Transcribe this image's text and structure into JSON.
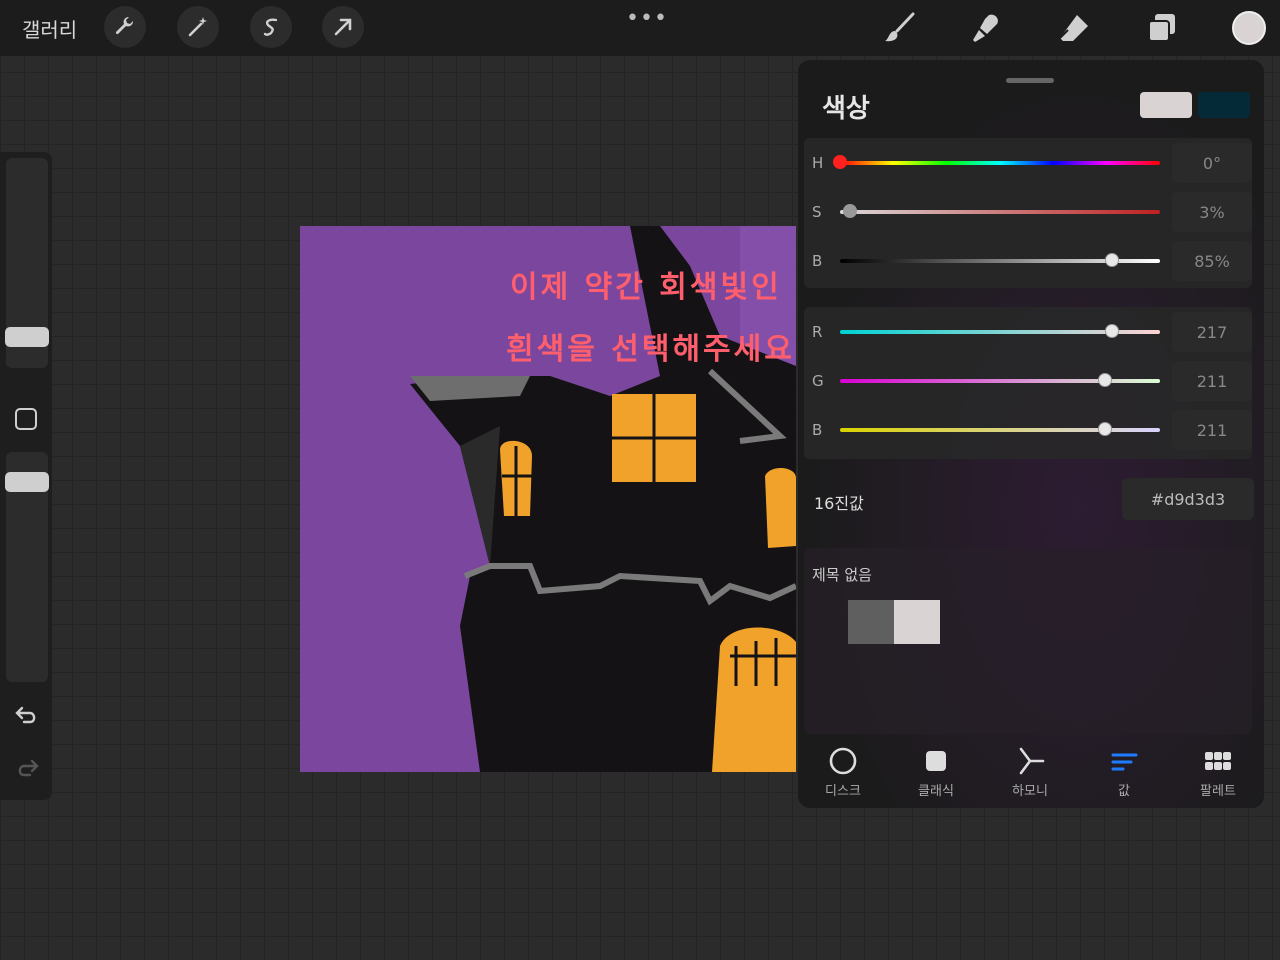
{
  "topbar": {
    "gallery_label": "갤러리",
    "tools": [
      "wrench-icon",
      "magic-wand-icon",
      "selection-icon",
      "transform-arrow-icon"
    ],
    "menu_dots": "•••",
    "right_tools": [
      "brush-icon",
      "smudge-icon",
      "eraser-icon",
      "layers-icon"
    ],
    "current_color": "#d9d3d3"
  },
  "canvas": {
    "text_line1": "이제 약간 회색빛인",
    "text_line2": "흰색을 선택해주세요.",
    "background": "#7a469e"
  },
  "panel": {
    "title": "색상",
    "primary_color": "#d9d3d3",
    "secondary_color": "#032a36",
    "hsb": [
      {
        "label": "H",
        "value": "0°",
        "fraction": 0.0
      },
      {
        "label": "S",
        "value": "3%",
        "fraction": 0.03
      },
      {
        "label": "B",
        "value": "85%",
        "fraction": 0.85
      }
    ],
    "rgb": [
      {
        "label": "R",
        "value": "217",
        "fraction": 0.851
      },
      {
        "label": "G",
        "value": "211",
        "fraction": 0.827
      },
      {
        "label": "B",
        "value": "211",
        "fraction": 0.827
      }
    ],
    "hex_label": "16진값",
    "hex_value": "#d9d3d3",
    "palette_name": "제목 없음",
    "palette_colors": [
      "#5f5f5f",
      "#d9d3d3"
    ],
    "tabs": [
      {
        "label": "디스크",
        "icon": "disc-icon",
        "active": false
      },
      {
        "label": "클래식",
        "icon": "classic-square-icon",
        "active": false
      },
      {
        "label": "하모니",
        "icon": "harmony-icon",
        "active": false
      },
      {
        "label": "값",
        "icon": "value-sliders-icon",
        "active": true
      },
      {
        "label": "팔레트",
        "icon": "palette-grid-icon",
        "active": false
      }
    ]
  }
}
